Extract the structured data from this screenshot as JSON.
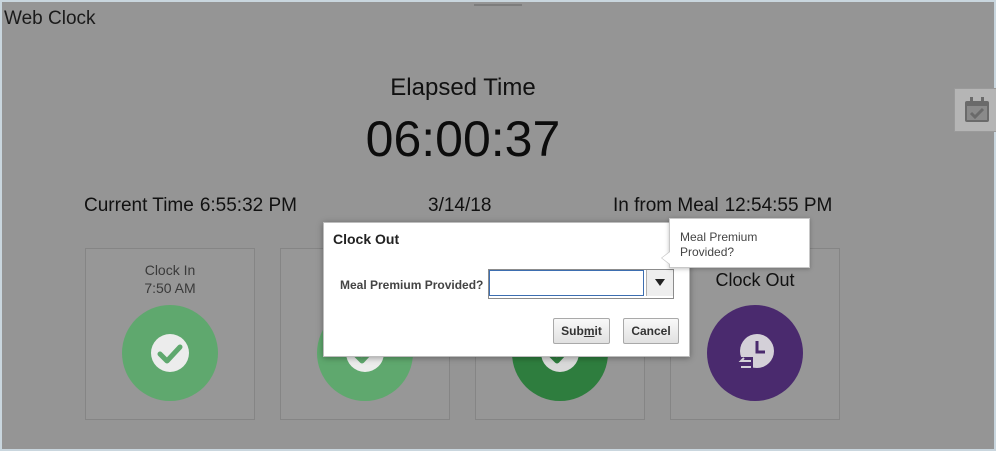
{
  "app": {
    "title": "Web Clock"
  },
  "elapsed": {
    "label": "Elapsed Time",
    "value": "06:00:37"
  },
  "status": {
    "current_time_label": "Current Time",
    "current_time_value": "6:55:32 PM",
    "date": "3/14/18",
    "meal_label": "In from Meal",
    "meal_value": "12:54:55 PM"
  },
  "tiles": [
    {
      "line1": "Clock In",
      "line2": "7:50 AM",
      "icon": "check-icon",
      "color": "#5fa86e"
    },
    {
      "line1": "",
      "line2": "",
      "icon": "check-icon",
      "color": "#5fa86e"
    },
    {
      "line1": "",
      "line2": "",
      "icon": "check-icon",
      "color": "#2e7d3e"
    },
    {
      "line1": "Clock Out",
      "line2": "",
      "icon": "clock-out-icon",
      "color": "#4a2a6e"
    }
  ],
  "dialog": {
    "title": "Clock Out",
    "field_label": "Meal Premium Provided?",
    "field_value": "",
    "submit_pre": "Sub",
    "submit_mnemonic": "m",
    "submit_post": "it",
    "cancel_label": "Cancel"
  },
  "tooltip": {
    "text": "Meal Premium Provided?"
  },
  "side_button": {
    "icon": "calendar-check-icon"
  },
  "colors": {
    "background": "#959595",
    "dialog_bg": "#ffffff",
    "accent_focus": "#3d6eb0"
  }
}
